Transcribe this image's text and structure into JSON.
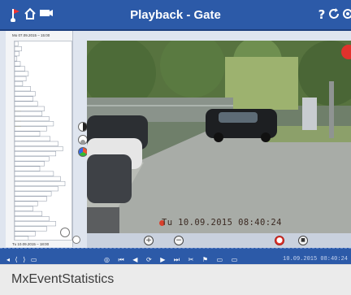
{
  "window": {
    "title": "Playback - Gate",
    "left_icons": [
      "flag-icon",
      "home-icon",
      "camera-icon"
    ],
    "right_icons": [
      "help-icon",
      "refresh-icon",
      "settings-icon"
    ],
    "help_glyph": "?",
    "refresh_glyph": "C",
    "accent": "#2c5aa8"
  },
  "timeline": {
    "start_label": "Mo 07.09.2015 – 15:00",
    "end_label": "Tu 10.09.2015 – 18:00",
    "highlight_color": "#e8d27a",
    "event_bars": [
      3,
      6,
      4,
      2,
      5,
      9,
      12,
      10,
      7,
      14,
      18,
      16,
      20,
      26,
      24,
      30,
      34,
      28,
      22,
      31,
      38,
      42,
      36,
      30,
      26,
      22,
      34,
      40,
      44,
      38,
      32,
      28,
      20,
      16,
      24,
      30,
      36,
      28,
      18,
      12
    ]
  },
  "video": {
    "osd_text": "Tu 10.09.2015  08:40:24"
  },
  "controls": {
    "zoom_in_glyph": "+",
    "zoom_out_glyph": "−",
    "record_glyph": "●",
    "stop_glyph": "■"
  },
  "navbar": {
    "left_glyphs": "◂ ⟨ ⟩ ▭",
    "mid_glyphs": "◎ ⏮ ◀ ⟳ ▶ ⏭ ✂ ⚑ ▭ ▭",
    "time": "10.09.2015 08:40:24"
  },
  "caption": "MxEventStatistics"
}
